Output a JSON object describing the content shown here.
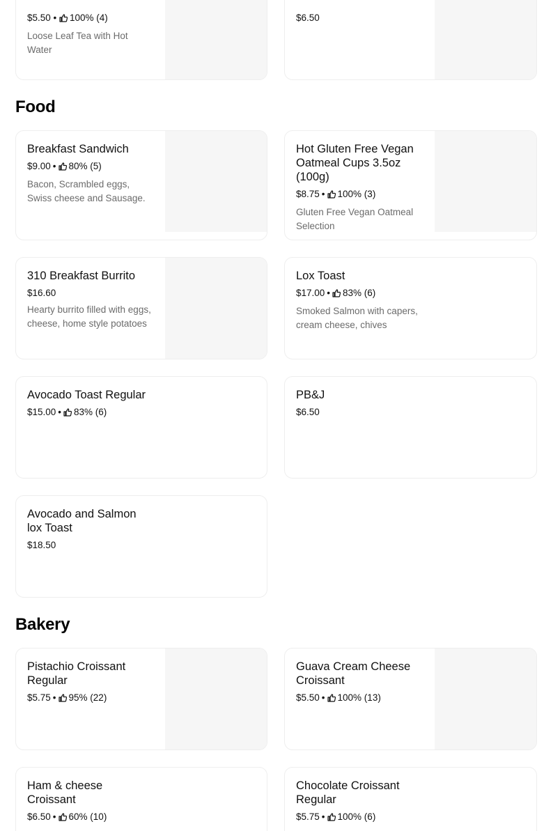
{
  "top": {
    "left": {
      "meta": "$5.50 • ",
      "rating": "100% (4)",
      "desc": "Loose Leaf Tea with Hot Water"
    },
    "right": {
      "meta": "$6.50"
    }
  },
  "sections": {
    "food": "Food",
    "bakery": "Bakery"
  },
  "food": [
    {
      "name": "Breakfast Sandwich",
      "price": "$9.00",
      "rating": "80% (5)",
      "desc": "Bacon, Scrambled eggs, Swiss cheese and Sausage."
    },
    {
      "name": "Hot Gluten Free Vegan Oatmeal Cups 3.5oz (100g)",
      "price": "$8.75",
      "rating": "100% (3)",
      "desc": "Gluten Free Vegan Oatmeal Selection"
    },
    {
      "name": "310 Breakfast Burrito",
      "price": "$16.60",
      "rating": "",
      "desc": "Hearty burrito filled with eggs, cheese, home style potatoes"
    },
    {
      "name": "Lox Toast",
      "price": "$17.00",
      "rating": "83% (6)",
      "desc": "Smoked Salmon with capers, cream cheese, chives"
    },
    {
      "name": "Avocado Toast Regular",
      "price": "$15.00",
      "rating": "83% (6)",
      "desc": ""
    },
    {
      "name": "PB&J",
      "price": "$6.50",
      "rating": "",
      "desc": ""
    },
    {
      "name": "Avocado and Salmon lox Toast",
      "price": "$18.50",
      "rating": "",
      "desc": ""
    }
  ],
  "bakery": [
    {
      "name": "Pistachio Croissant Regular",
      "price": "$5.75",
      "rating": "95% (22)"
    },
    {
      "name": "Guava Cream Cheese Croissant",
      "price": "$5.50",
      "rating": "100% (13)"
    },
    {
      "name": "Ham & cheese Croissant",
      "price": "$6.50",
      "rating": "60% (10)"
    },
    {
      "name": "Chocolate Croissant Regular",
      "price": "$5.75",
      "rating": "100% (6)"
    }
  ],
  "icons": {
    "rating": "thumbs-up-icon"
  },
  "colors": {
    "placeholder": "#f6f6f6",
    "border": "#eeeeee",
    "muted": "#6b6b6b"
  }
}
